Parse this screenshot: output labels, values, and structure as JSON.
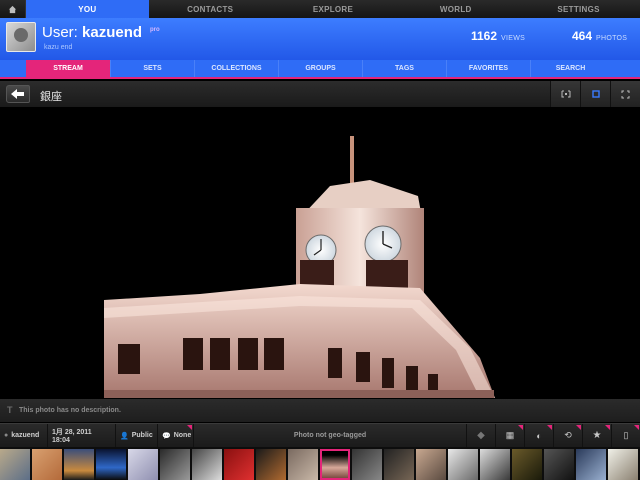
{
  "topnav": {
    "items": [
      "YOU",
      "CONTACTS",
      "EXPLORE",
      "WORLD",
      "SETTINGS"
    ]
  },
  "user": {
    "label_prefix": "User:",
    "username": "kazuend",
    "badge": "pro",
    "realname": "kazu end",
    "views_value": "1162",
    "views_label": "VIEWS",
    "photos_value": "464",
    "photos_label": "PHOTOS"
  },
  "subtabs": [
    "STREAM",
    "SETS",
    "COLLECTIONS",
    "GROUPS",
    "TAGS",
    "FAVORITES",
    "SEARCH"
  ],
  "photo": {
    "title": "銀座",
    "description": "This photo has no description."
  },
  "meta": {
    "owner": "kazuend",
    "date": "1月 28, 2011 18:04",
    "privacy": "Public",
    "license": "None",
    "geo": "Photo not geo-tagged"
  },
  "colors": {
    "accent_blue": "#2f6cf6",
    "accent_pink": "#e4257a"
  },
  "icons": [
    "home-icon",
    "back-arrow-icon",
    "fit-view-icon",
    "square-view-icon",
    "fullscreen-icon",
    "tag-icon",
    "grid-icon",
    "face-icon",
    "rotate-icon",
    "star-icon",
    "phone-icon"
  ],
  "filmstrip_count": 22
}
